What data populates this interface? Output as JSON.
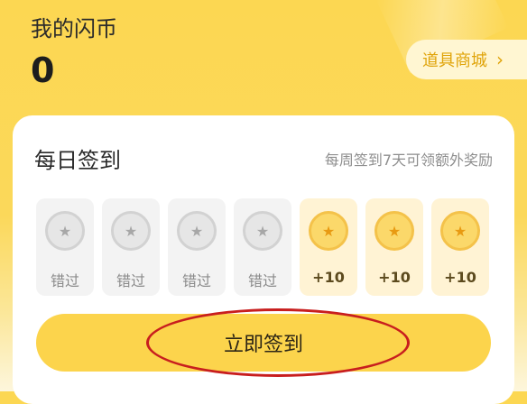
{
  "header": {
    "coins_label": "我的闪币",
    "coins_value": "0",
    "shop_button": "道具商城"
  },
  "checkin": {
    "title": "每日签到",
    "hint": "每周签到7天可领额外奖励",
    "days": [
      {
        "status": "missed",
        "label": "错过",
        "icon": "star-coin-gray"
      },
      {
        "status": "missed",
        "label": "错过",
        "icon": "star-coin-gray"
      },
      {
        "status": "missed",
        "label": "错过",
        "icon": "star-coin-gray"
      },
      {
        "status": "missed",
        "label": "错过",
        "icon": "star-coin-gray"
      },
      {
        "status": "available",
        "label": "+10",
        "icon": "star-coin-gold"
      },
      {
        "status": "available",
        "label": "+10",
        "icon": "star-coin-gold"
      },
      {
        "status": "available",
        "label": "+10",
        "icon": "star-coin-gold"
      }
    ],
    "button_label": "立即签到"
  },
  "colors": {
    "background": "#fcd752",
    "accent": "#fcd44c",
    "shop_text": "#e0a40a",
    "annotation": "#c81e1e"
  }
}
